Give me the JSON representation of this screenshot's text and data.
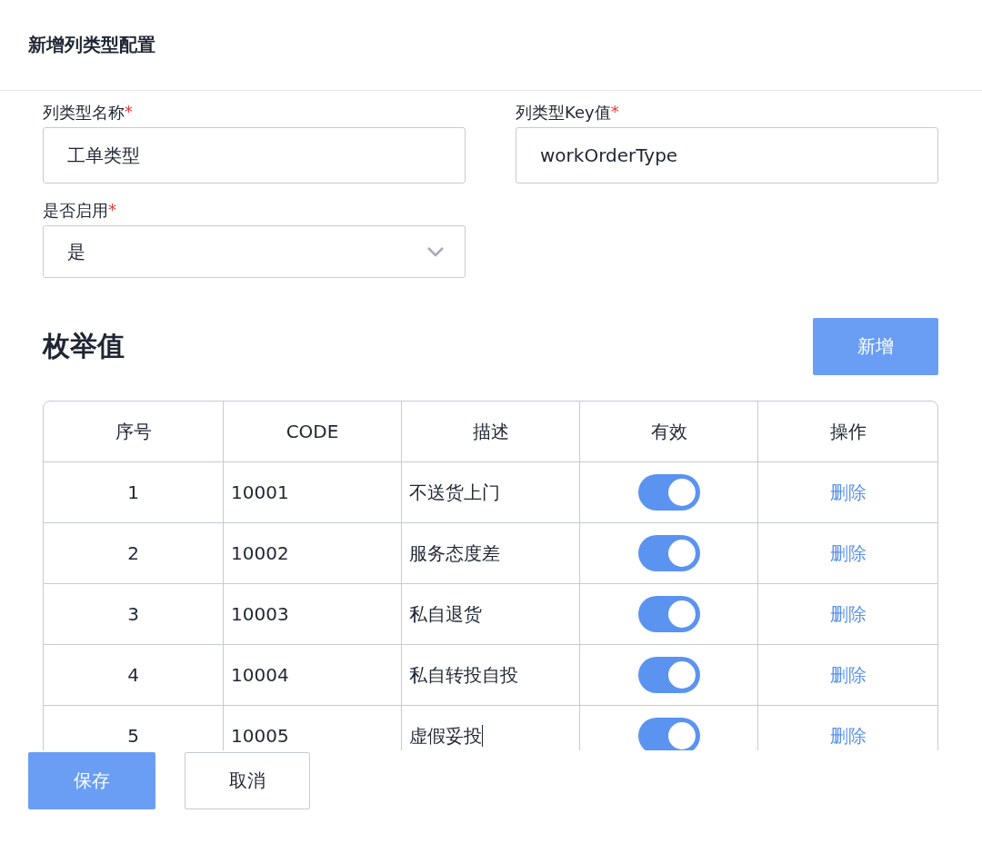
{
  "dialog": {
    "title": "新增列类型配置"
  },
  "fields": [
    {
      "kind": "input",
      "label": "列类型名称",
      "required_mark": "*",
      "value": "工单类型"
    },
    {
      "kind": "input",
      "label": "列类型Key值",
      "required_mark": "*",
      "value": "workOrderType"
    },
    {
      "kind": "select",
      "label": "是否启用",
      "required_mark": "*",
      "value": "是"
    }
  ],
  "section": {
    "title": "枚举值",
    "add_button": "新增"
  },
  "table": {
    "columns": [
      "序号",
      "CODE",
      "描述",
      "有效",
      "操作"
    ],
    "rows": [
      {
        "index": "1",
        "code": "10001",
        "description": "不送货上门",
        "valid": true,
        "action": "删除"
      },
      {
        "index": "2",
        "code": "10002",
        "description": "服务态度差",
        "valid": true,
        "action": "删除"
      },
      {
        "index": "3",
        "code": "10003",
        "description": "私自退货",
        "valid": true,
        "action": "删除"
      },
      {
        "index": "4",
        "code": "10004",
        "description": "私自转投自投",
        "valid": true,
        "action": "删除"
      },
      {
        "index": "5",
        "code": "10005",
        "description": "虚假妥投",
        "valid": true,
        "action": "删除",
        "editing": true
      }
    ]
  },
  "footer": {
    "buttons": [
      {
        "label": "保存",
        "kind": "primary"
      },
      {
        "label": "取消",
        "kind": "default"
      }
    ]
  }
}
